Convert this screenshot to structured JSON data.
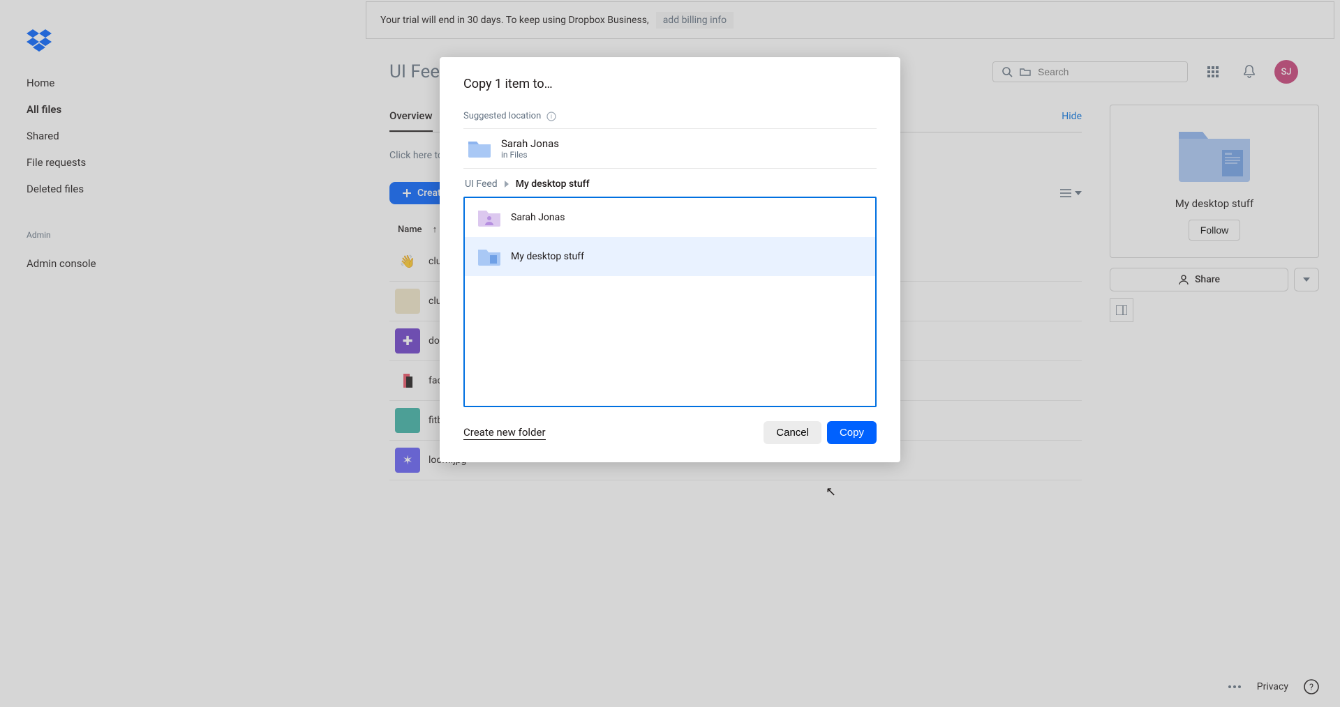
{
  "trial_banner": {
    "text": "Your trial will end in 30 days. To keep using Dropbox Business,",
    "link": "add billing info"
  },
  "breadcrumb": {
    "parent": "UI Feed",
    "sep": "›",
    "current": "My desktop stuff"
  },
  "search": {
    "placeholder": "Search"
  },
  "avatar": {
    "initials": "SJ"
  },
  "sidebar": {
    "items": [
      {
        "label": "Home"
      },
      {
        "label": "All files",
        "active": true
      },
      {
        "label": "Shared"
      },
      {
        "label": "File requests"
      },
      {
        "label": "Deleted files"
      }
    ],
    "admin_section": {
      "title": "Admin",
      "items": [
        {
          "label": "Admin console"
        }
      ]
    }
  },
  "tabs": {
    "overview": "Overview",
    "hide": "Hide"
  },
  "desc_hint": "Click here to desc",
  "create_btn": "Create",
  "col_name": "Name",
  "files": [
    {
      "name": "clubhouse.",
      "thumb_bg": "#fff",
      "thumb_text": "👋"
    },
    {
      "name": "clubhouseO",
      "thumb_bg": "#f0e5c7",
      "thumb_text": ""
    },
    {
      "name": "dovetail.jpg",
      "thumb_bg": "#6b3dc9",
      "thumb_text": ""
    },
    {
      "name": "facet.jpg",
      "thumb_bg": "#fff",
      "thumb_text": ""
    },
    {
      "name": "fitbitOnboa",
      "thumb_bg": "#3ab0a4",
      "thumb_text": ""
    },
    {
      "name": "loom.jpg",
      "thumb_bg": "#625cf5",
      "thumb_text": ""
    }
  ],
  "side_panel": {
    "title": "My desktop stuff",
    "follow": "Follow",
    "share": "Share"
  },
  "modal": {
    "title": "Copy 1 item to…",
    "suggested_label": "Suggested location",
    "suggested": {
      "name": "Sarah Jonas",
      "path": "in Files"
    },
    "breadcrumb": {
      "parent": "UI Feed",
      "current": "My desktop stuff"
    },
    "folders": [
      {
        "name": "Sarah Jonas",
        "type": "person"
      },
      {
        "name": "My desktop stuff",
        "type": "team",
        "selected": true
      }
    ],
    "create_folder": "Create new folder",
    "cancel": "Cancel",
    "copy": "Copy"
  },
  "footer": {
    "privacy": "Privacy"
  }
}
